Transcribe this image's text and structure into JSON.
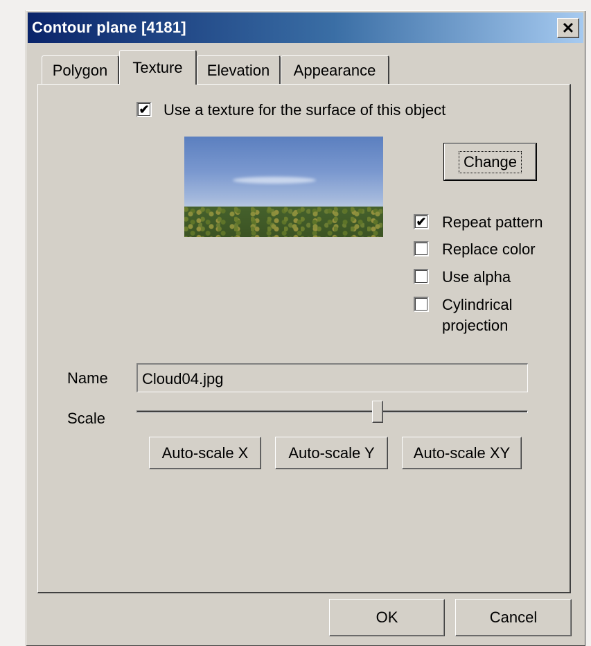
{
  "window": {
    "title": "Contour plane [4181]",
    "close_glyph": "✕"
  },
  "tabs": [
    {
      "label": "Polygon",
      "active": false
    },
    {
      "label": "Texture",
      "active": true
    },
    {
      "label": "Elevation",
      "active": false
    },
    {
      "label": "Appearance",
      "active": false
    }
  ],
  "texture": {
    "use_texture_label": "Use a texture for the surface of this object",
    "use_texture_checked": true,
    "change_label": "Change",
    "options": [
      {
        "label": "Repeat pattern",
        "checked": true
      },
      {
        "label": "Replace color",
        "checked": false
      },
      {
        "label": "Use alpha",
        "checked": false
      },
      {
        "label": "Cylindrical\nprojection",
        "label_line1": "Cylindrical",
        "label_line2": "projection",
        "checked": false
      }
    ],
    "name_label": "Name",
    "name_value": "Cloud04.jpg",
    "scale_label": "Scale",
    "scale_value": 0.62,
    "autoscale_x": "Auto-scale X",
    "autoscale_y": "Auto-scale Y",
    "autoscale_xy": "Auto-scale XY"
  },
  "footer": {
    "ok_label": "OK",
    "cancel_label": "Cancel"
  },
  "colors": {
    "titlebar_start": "#0a246a",
    "titlebar_end": "#a6caf0",
    "face": "#d4d0c8"
  },
  "check_glyph": "✔"
}
